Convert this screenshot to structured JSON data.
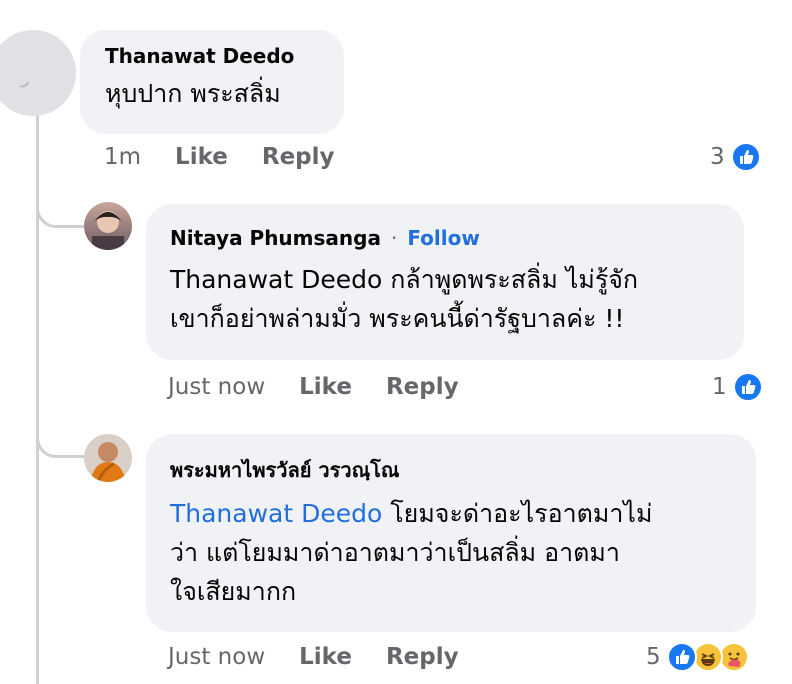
{
  "comments": [
    {
      "author": "Thanawat Deedo",
      "text": "หุบปาก พระสลิ่ม",
      "time": "1m",
      "like_label": "Like",
      "reply_label": "Reply",
      "reaction_count": "3",
      "reactions": [
        "like-icon"
      ]
    },
    {
      "author": "Nitaya Phumsanga",
      "separator": "·",
      "follow_label": "Follow",
      "mention": "Thanawat Deedo",
      "text_line1": " กล้าพูดพระสลิ่ม ไม่รู้จัก",
      "text_line2": "เขาก็อย่าพล่ามมั่ว พระคนนี้ด่ารัฐบาลค่ะ !!",
      "time": "Just now",
      "like_label": "Like",
      "reply_label": "Reply",
      "reaction_count": "1",
      "reactions": [
        "like-icon"
      ]
    },
    {
      "author": "พระมหาไพรวัลย์ วรวณฺโณ",
      "mention": "Thanawat Deedo",
      "text_line1": " โยมจะด่าอะไรอาตมาไม่",
      "text_line2": "ว่า แต่โยมมาด่าอาตมาว่าเป็นสลิ่ม อาตมา",
      "text_line3": "ใจเสียมากก",
      "time": "Just now",
      "like_label": "Like",
      "reply_label": "Reply",
      "reaction_count": "5",
      "reactions": [
        "like-icon",
        "haha-icon",
        "care-icon"
      ]
    }
  ],
  "colors": {
    "bubble": "#f0f2f5",
    "mention": "#216fdb",
    "meta": "#65676b",
    "like_blue": "#1877f2"
  }
}
